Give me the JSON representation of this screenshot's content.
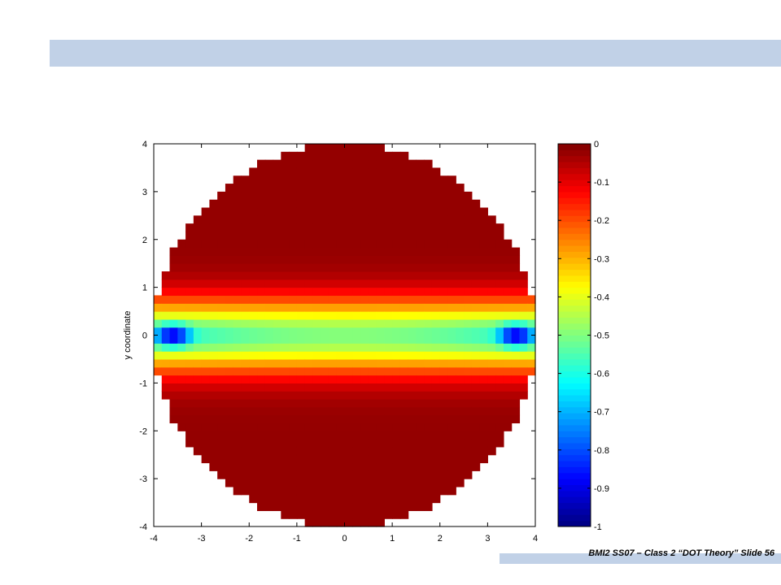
{
  "slide": {
    "footer": "BMI2 SS07 – Class 2 “DOT Theory” Slide 56",
    "band_color": "#c1d1e7"
  },
  "chart_data": {
    "type": "heatmap",
    "title": "",
    "xlabel": "",
    "ylabel": "y coordinate",
    "xlim": [
      -4,
      4
    ],
    "ylim": [
      -4,
      4
    ],
    "xticks": [
      "-4",
      "-3",
      "-2",
      "-1",
      "0",
      "1",
      "2",
      "3",
      "4"
    ],
    "yticks": [
      "4",
      "3",
      "2",
      "1",
      "0",
      "-1",
      "-2",
      "-3",
      "-4"
    ],
    "colorbar": {
      "colormap": "jet",
      "range": [
        -1,
        0
      ],
      "ticks": [
        "0",
        "-0.1",
        "-0.2",
        "-0.3",
        "-0.4",
        "-0.5",
        "-0.6",
        "-0.7",
        "-0.8",
        "-0.9",
        "-1"
      ]
    },
    "field": {
      "domain": "disk",
      "radius": 4,
      "background_value": -0.02,
      "band_center_y": 0,
      "band_peak_value": -0.5,
      "band_half_width_y": 0.75,
      "minima": [
        {
          "x": -3.6,
          "y": 0,
          "value": -0.92
        },
        {
          "x": 3.6,
          "y": 0,
          "value": -0.92
        }
      ]
    }
  }
}
